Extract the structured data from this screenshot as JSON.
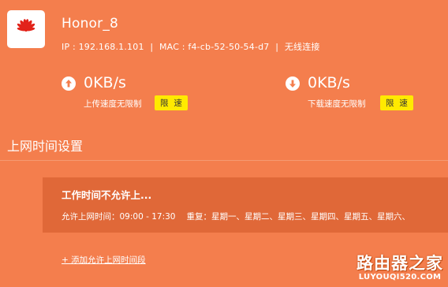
{
  "device": {
    "name": "Honor_8",
    "ip_label": "IP : 192.168.1.101",
    "mac_label": "MAC : f4-cb-52-50-54-d7",
    "connection": "无线连接",
    "separator": "|",
    "logo_icon": "huawei-logo-icon",
    "logo_color": "#e2231a"
  },
  "upload": {
    "icon": "arrow-up-circle-icon",
    "speed": "0KB/s",
    "label": "上传速度无限制",
    "limit_button": "限 速"
  },
  "download": {
    "icon": "arrow-down-circle-icon",
    "speed": "0KB/s",
    "label": "下载速度无限制",
    "limit_button": "限 速"
  },
  "schedule": {
    "section_title": "上网时间设置",
    "rule": {
      "title": "工作时间不允许上...",
      "time": "允许上网时间：09:00 - 17:30",
      "repeat": "重复：星期一、星期二、星期三、星期四、星期五、星期六、"
    },
    "add_link": "+ 添加允许上网时间段"
  },
  "watermark": {
    "main": "路由器之家",
    "sub": "LUYOUQI520.COM"
  },
  "colors": {
    "background": "#f47e4d",
    "card": "#e06838",
    "limit_button": "#ffea00"
  }
}
